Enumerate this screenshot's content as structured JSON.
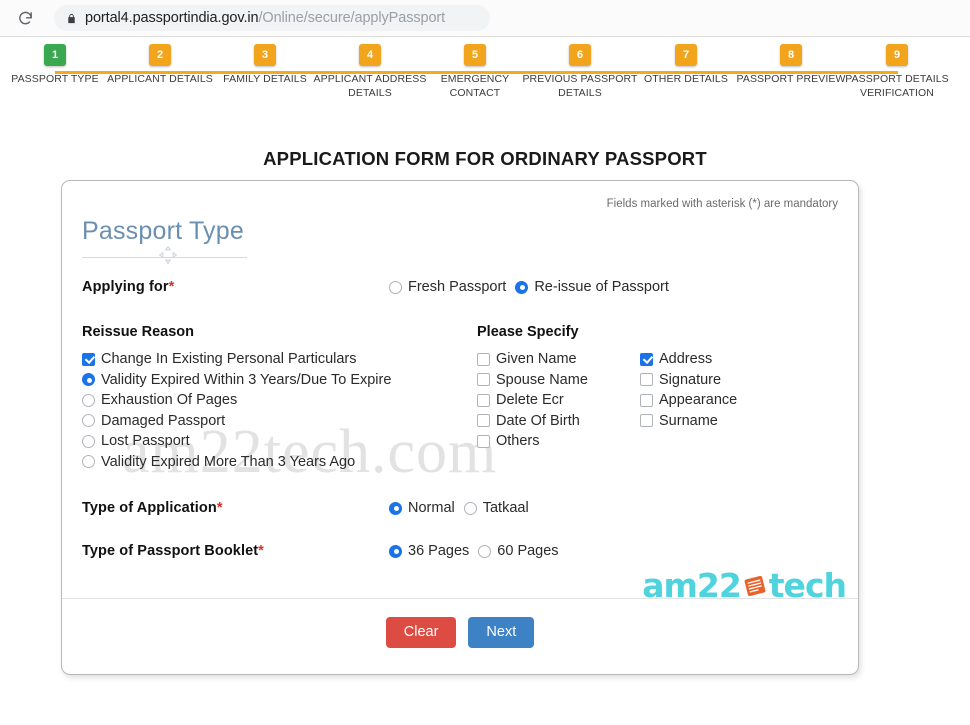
{
  "browser": {
    "reload_icon": "reload-icon",
    "lock_icon": "lock-icon",
    "url_host": "portal4.passportindia.gov.in",
    "url_path": "/Online/secure/applyPassport"
  },
  "stepper": {
    "steps": [
      {
        "number": "1",
        "label": "PASSPORT TYPE",
        "state": "active"
      },
      {
        "number": "2",
        "label": "APPLICANT DETAILS",
        "state": "todo"
      },
      {
        "number": "3",
        "label": "FAMILY DETAILS",
        "state": "todo"
      },
      {
        "number": "4",
        "label": "APPLICANT ADDRESS DETAILS",
        "state": "todo"
      },
      {
        "number": "5",
        "label": "EMERGENCY CONTACT",
        "state": "todo"
      },
      {
        "number": "6",
        "label": "PREVIOUS PASSPORT DETAILS",
        "state": "todo"
      },
      {
        "number": "7",
        "label": "OTHER DETAILS",
        "state": "todo"
      },
      {
        "number": "8",
        "label": "PASSPORT PREVIEW",
        "state": "todo"
      },
      {
        "number": "9",
        "label": "PASSPORT DETAILS VERIFICATION",
        "state": "todo"
      }
    ]
  },
  "page_title": "APPLICATION FORM FOR ORDINARY PASSPORT",
  "card": {
    "mandatory_note": "Fields marked with asterisk (*) are mandatory",
    "section_heading": "Passport Type",
    "watermark": "am22tech.com",
    "logo": {
      "text_left": "am22",
      "text_right": "tech",
      "icon": "book-icon"
    },
    "applying_for": {
      "label": "Applying for",
      "required": "*",
      "options": [
        {
          "label": "Fresh Passport",
          "selected": false
        },
        {
          "label": "Re-issue of Passport",
          "selected": true
        }
      ]
    },
    "reissue_reason": {
      "title": "Reissue Reason",
      "options": [
        {
          "label": "Change In Existing Personal Particulars",
          "control": "checkbox",
          "selected": true
        },
        {
          "label": "Validity Expired Within 3 Years/Due To Expire",
          "control": "radio",
          "selected": true
        },
        {
          "label": "Exhaustion Of Pages",
          "control": "radio",
          "selected": false
        },
        {
          "label": "Damaged Passport",
          "control": "radio",
          "selected": false
        },
        {
          "label": "Lost Passport",
          "control": "radio",
          "selected": false
        },
        {
          "label": "Validity Expired More Than 3 Years Ago",
          "control": "radio",
          "selected": false
        }
      ]
    },
    "please_specify": {
      "title": "Please Specify",
      "column_left": [
        {
          "label": "Given Name",
          "selected": false
        },
        {
          "label": "Spouse Name",
          "selected": false
        },
        {
          "label": "Delete Ecr",
          "selected": false
        },
        {
          "label": "Date Of Birth",
          "selected": false
        },
        {
          "label": "Others",
          "selected": false
        }
      ],
      "column_right": [
        {
          "label": "Address",
          "selected": true
        },
        {
          "label": "Signature",
          "selected": false
        },
        {
          "label": "Appearance",
          "selected": false
        },
        {
          "label": "Surname",
          "selected": false
        }
      ]
    },
    "type_of_application": {
      "label": "Type of Application",
      "required": "*",
      "options": [
        {
          "label": "Normal",
          "selected": true
        },
        {
          "label": "Tatkaal",
          "selected": false
        }
      ]
    },
    "type_of_booklet": {
      "label": "Type of Passport Booklet",
      "required": "*",
      "options": [
        {
          "label": "36 Pages",
          "selected": true
        },
        {
          "label": "60 Pages",
          "selected": false
        }
      ]
    },
    "buttons": {
      "clear": "Clear",
      "next": "Next"
    }
  },
  "colors": {
    "step_active": "#3aa851",
    "step_todo": "#f2a41c",
    "accent_blue": "#1a73e8",
    "clear_red": "#dc4c42",
    "next_blue": "#3c82c4",
    "heading_slate": "#6b8fb0",
    "logo_cyan": "#4fd3dd",
    "logo_orange": "#e8622a"
  }
}
